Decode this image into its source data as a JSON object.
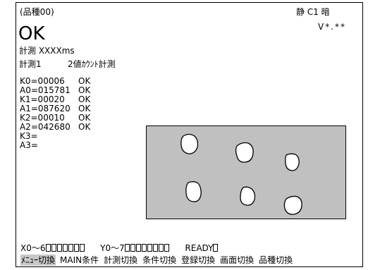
{
  "header": {
    "product": "(品種00)",
    "status": "静  C1  暗",
    "version": "V*.**"
  },
  "result": "OK",
  "measure_time": "計測 XXXXms",
  "mode": {
    "name": "計測1",
    "type": "2値ｶｳﾝﾄ計測"
  },
  "registers": [
    {
      "name": "K0=00006",
      "result": "OK"
    },
    {
      "name": "A0=015781",
      "result": "OK"
    },
    {
      "name": "K1=00020",
      "result": "OK"
    },
    {
      "name": "A1=087620",
      "result": "OK"
    },
    {
      "name": "K2=00010",
      "result": "OK"
    },
    {
      "name": "A2=042680",
      "result": "OK"
    },
    {
      "name": "K3=",
      "result": ""
    },
    {
      "name": "A3=",
      "result": ""
    }
  ],
  "io": {
    "x_label": "X0～6",
    "y_label": "Y0～7",
    "ready_label": "READY"
  },
  "menu": [
    {
      "label": "ﾒﾆｭｰ切換",
      "selected": true
    },
    {
      "label": "MAIN条件",
      "selected": false
    },
    {
      "label": "計測切換",
      "selected": false
    },
    {
      "label": "条件切換",
      "selected": false
    },
    {
      "label": "登録切換",
      "selected": false
    },
    {
      "label": "画面切換",
      "selected": false
    },
    {
      "label": "品種切換",
      "selected": false
    }
  ],
  "colors": {
    "panel": "#c0c0c0",
    "menu_selected": "#c8c8c8"
  }
}
